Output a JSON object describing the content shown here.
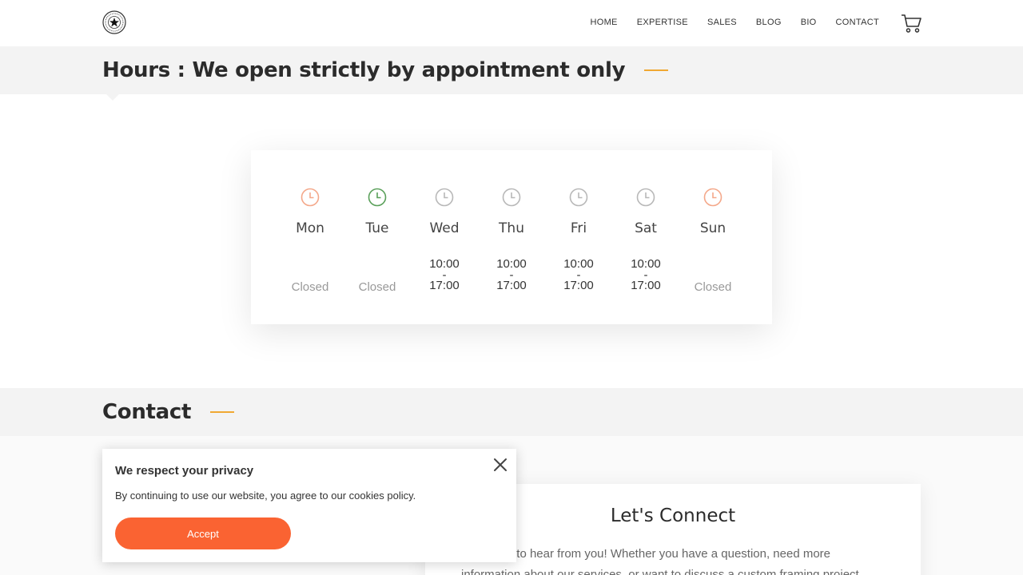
{
  "nav": {
    "items": [
      "HOME",
      "EXPERTISE",
      "SALES",
      "BLOG",
      "BIO",
      "CONTACT"
    ]
  },
  "hours": {
    "title": "Hours : We open strictly by appointment only",
    "days": [
      {
        "name": "Mon",
        "status": "Closed",
        "open": "",
        "close": ""
      },
      {
        "name": "Tue",
        "status": "Closed",
        "open": "",
        "close": ""
      },
      {
        "name": "Wed",
        "status": "",
        "open": "10:00",
        "close": "17:00"
      },
      {
        "name": "Thu",
        "status": "",
        "open": "10:00",
        "close": "17:00"
      },
      {
        "name": "Fri",
        "status": "",
        "open": "10:00",
        "close": "17:00"
      },
      {
        "name": "Sat",
        "status": "",
        "open": "10:00",
        "close": "17:00"
      },
      {
        "name": "Sun",
        "status": "Closed",
        "open": "",
        "close": ""
      }
    ],
    "separator": "-"
  },
  "contact": {
    "title": "Contact",
    "connect_title": "Let's Connect",
    "connect_text": "We'd love to hear from you! Whether you have a question, need more information about our services, or want to discuss a custom framing project"
  },
  "privacy": {
    "title": "We respect your privacy",
    "text": "By continuing to use our website, you agree to our cookies policy.",
    "accept_label": "Accept"
  },
  "colors": {
    "accent": "#f0a832",
    "button": "#fa6332",
    "clock_closed": "#f4a88a",
    "clock_today": "#5aa05a",
    "clock_open": "#b8b8b8"
  }
}
